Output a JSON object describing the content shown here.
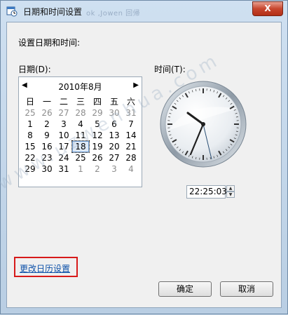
{
  "window": {
    "title": "日期和时间设置",
    "ghost_title": "ok ,Jowen 回帰",
    "close_label": "X"
  },
  "main": {
    "heading": "设置日期和时间:",
    "date_label": "日期(D):",
    "time_label": "时间(T):",
    "time_value": "22:25:03",
    "change_calendar_link": "更改日历设置"
  },
  "calendar": {
    "month_title": "2010年8月",
    "weekdays": [
      "日",
      "一",
      "二",
      "三",
      "四",
      "五",
      "六"
    ],
    "weeks": [
      [
        "25",
        "26",
        "27",
        "28",
        "29",
        "30",
        "31"
      ],
      [
        "1",
        "2",
        "3",
        "4",
        "5",
        "6",
        "7"
      ],
      [
        "8",
        "9",
        "10",
        "11",
        "12",
        "13",
        "14"
      ],
      [
        "15",
        "16",
        "17",
        "18",
        "19",
        "20",
        "21"
      ],
      [
        "22",
        "23",
        "24",
        "25",
        "26",
        "27",
        "28"
      ],
      [
        "29",
        "30",
        "31",
        "1",
        "2",
        "3",
        "4"
      ]
    ],
    "selected_day": "18"
  },
  "buttons": {
    "ok": "确定",
    "cancel": "取消"
  },
  "watermark": "www.uzwenhua.com",
  "colors": {
    "link": "#0b4fa8",
    "highlight_border": "#d71a1a"
  },
  "icons": {
    "title": "calendar-clock-icon",
    "prev": "left-arrow-icon",
    "next": "right-arrow-icon"
  }
}
